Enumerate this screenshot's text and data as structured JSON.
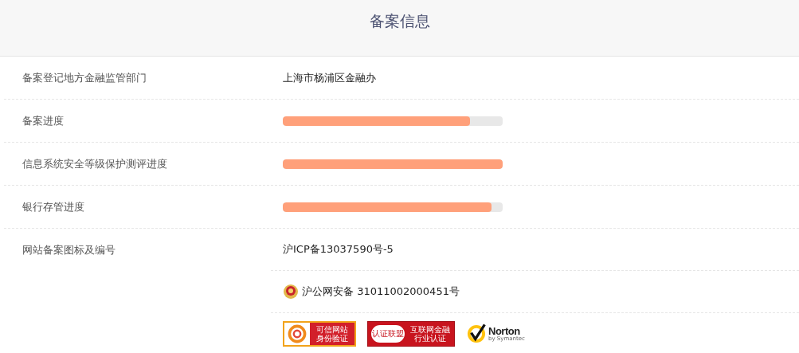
{
  "header": {
    "title": "备案信息"
  },
  "rows": [
    {
      "label": "备案登记地方金融监管部门",
      "kind": "text",
      "value": "上海市杨浦区金融办"
    },
    {
      "label": "备案进度",
      "kind": "progress",
      "level": 0.85
    },
    {
      "label": "信息系统安全等级保护测评进度",
      "kind": "progress",
      "level": 1.0
    },
    {
      "label": "银行存管进度",
      "kind": "progress",
      "level": 0.95
    },
    {
      "label": "网站备案图标及编号",
      "kind": "records",
      "items": [
        {
          "kind": "icp",
          "text": "沪ICP备13037590号-5"
        },
        {
          "kind": "police",
          "text": "沪公网安备 31011002000451号"
        },
        {
          "kind": "badges",
          "badges": [
            {
              "kind": "trusted",
              "line1": "可信网站",
              "line2": "身份验证"
            },
            {
              "kind": "finance",
              "line1": "互联网金融",
              "line2": "行业认证",
              "seal": "认证联盟"
            },
            {
              "kind": "norton",
              "line1": "Norton",
              "line2": "by Symantec"
            }
          ]
        }
      ]
    }
  ]
}
